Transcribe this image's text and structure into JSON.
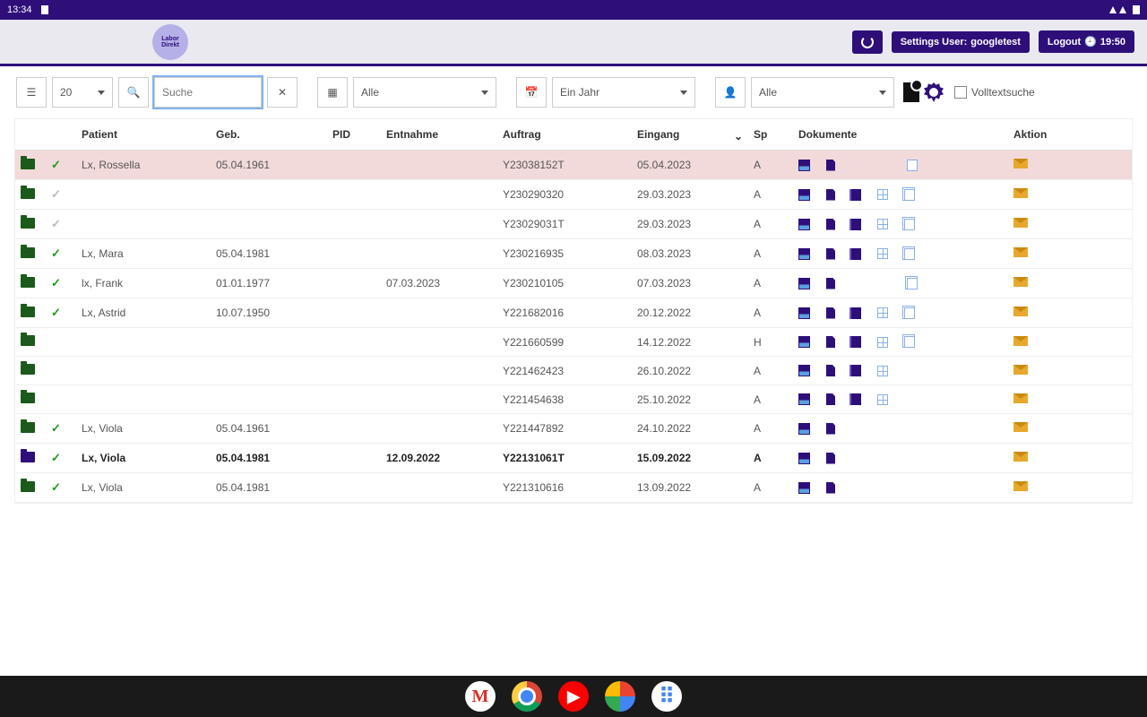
{
  "statusbar": {
    "time": "13:34"
  },
  "header": {
    "refresh": "",
    "settings_prefix": "Settings User: ",
    "settings_user": "googletest",
    "logout": "Logout",
    "logout_time": "19:50"
  },
  "filters": {
    "page_size": "20",
    "search_placeholder": "Suche",
    "type_all": "Alle",
    "date_range": "Ein Jahr",
    "user_all": "Alle",
    "fulltext_label": "Volltextsuche"
  },
  "columns": {
    "patient": "Patient",
    "geb": "Geb.",
    "pid": "PID",
    "entnahme": "Entnahme",
    "auftrag": "Auftrag",
    "eingang": "Eingang",
    "sp": "Sp",
    "dokumente": "Dokumente",
    "aktion": "Aktion"
  },
  "rows": [
    {
      "folder": "green",
      "check": "green",
      "patient": "Lx, Rossella",
      "geb": "05.04.1961",
      "pid": "",
      "entnahme": "",
      "auftrag": "Y23038152T",
      "eingang": "05.04.2023",
      "sp": "A",
      "docs": [
        true,
        true,
        false,
        false,
        true
      ],
      "bold": false,
      "highlight": true
    },
    {
      "folder": "green",
      "check": "gray",
      "patient": "",
      "geb": "",
      "pid": "",
      "entnahme": "",
      "auftrag": "Y230290320",
      "eingang": "29.03.2023",
      "sp": "A",
      "docs": [
        true,
        true,
        true,
        true,
        true
      ],
      "bold": false,
      "highlight": false
    },
    {
      "folder": "green",
      "check": "gray",
      "patient": "",
      "geb": "",
      "pid": "",
      "entnahme": "",
      "auftrag": "Y23029031T",
      "eingang": "29.03.2023",
      "sp": "A",
      "docs": [
        true,
        true,
        true,
        true,
        true
      ],
      "bold": false,
      "highlight": false
    },
    {
      "folder": "green",
      "check": "green",
      "patient": "Lx, Mara",
      "geb": "05.04.1981",
      "pid": "",
      "entnahme": "",
      "auftrag": "Y230216935",
      "eingang": "08.03.2023",
      "sp": "A",
      "docs": [
        true,
        true,
        true,
        true,
        true
      ],
      "bold": false,
      "highlight": false
    },
    {
      "folder": "green",
      "check": "green",
      "patient": "lx, Frank",
      "geb": "01.01.1977",
      "pid": "",
      "entnahme": "07.03.2023",
      "auftrag": "Y230210105",
      "eingang": "07.03.2023",
      "sp": "A",
      "docs": [
        true,
        true,
        false,
        false,
        true
      ],
      "bold": false,
      "highlight": false
    },
    {
      "folder": "green",
      "check": "green",
      "patient": "Lx, Astrid",
      "geb": "10.07.1950",
      "pid": "",
      "entnahme": "",
      "auftrag": "Y221682016",
      "eingang": "20.12.2022",
      "sp": "A",
      "docs": [
        true,
        true,
        true,
        true,
        true
      ],
      "bold": false,
      "highlight": false
    },
    {
      "folder": "green",
      "check": "",
      "patient": "",
      "geb": "",
      "pid": "",
      "entnahme": "",
      "auftrag": "Y221660599",
      "eingang": "14.12.2022",
      "sp": "H",
      "docs": [
        true,
        true,
        true,
        true,
        true
      ],
      "bold": false,
      "highlight": false
    },
    {
      "folder": "green",
      "check": "",
      "patient": "",
      "geb": "",
      "pid": "",
      "entnahme": "",
      "auftrag": "Y221462423",
      "eingang": "26.10.2022",
      "sp": "A",
      "docs": [
        true,
        true,
        true,
        true,
        false
      ],
      "bold": false,
      "highlight": false
    },
    {
      "folder": "green",
      "check": "",
      "patient": "",
      "geb": "",
      "pid": "",
      "entnahme": "",
      "auftrag": "Y221454638",
      "eingang": "25.10.2022",
      "sp": "A",
      "docs": [
        true,
        true,
        true,
        true,
        false
      ],
      "bold": false,
      "highlight": false
    },
    {
      "folder": "green",
      "check": "green",
      "patient": "Lx, Viola",
      "geb": "05.04.1961",
      "pid": "",
      "entnahme": "",
      "auftrag": "Y221447892",
      "eingang": "24.10.2022",
      "sp": "A",
      "docs": [
        true,
        true,
        false,
        false,
        false
      ],
      "bold": false,
      "highlight": false
    },
    {
      "folder": "blue",
      "check": "green",
      "patient": "Lx, Viola",
      "geb": "05.04.1981",
      "pid": "",
      "entnahme": "12.09.2022",
      "auftrag": "Y22131061T",
      "eingang": "15.09.2022",
      "sp": "A",
      "docs": [
        true,
        true,
        false,
        false,
        false
      ],
      "bold": true,
      "highlight": false
    },
    {
      "folder": "green",
      "check": "green",
      "patient": "Lx, Viola",
      "geb": "05.04.1981",
      "pid": "",
      "entnahme": "",
      "auftrag": "Y221310616",
      "eingang": "13.09.2022",
      "sp": "A",
      "docs": [
        true,
        true,
        false,
        false,
        false
      ],
      "bold": false,
      "highlight": false
    }
  ]
}
